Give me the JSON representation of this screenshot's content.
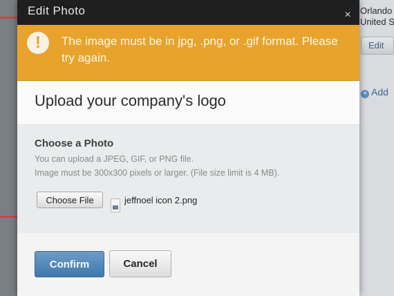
{
  "dialog": {
    "title": "Edit Photo",
    "close_label": "×",
    "alert": {
      "icon": "exclamation-icon",
      "icon_glyph": "!",
      "message": "The image must be in jpg, .png, or .gif format. Please try again."
    },
    "heading": "Upload your company's logo",
    "upload": {
      "title": "Choose a Photo",
      "help_line1": "You can upload a JPEG, GIF, or PNG file.",
      "help_line2": "Image must be 300x300 pixels or larger. (File size limit is 4 MB).",
      "choose_file_label": "Choose File",
      "file_name": "jeffnoel icon 2.png"
    },
    "buttons": {
      "confirm": "Confirm",
      "cancel": "Cancel"
    }
  },
  "background_page": {
    "city": "Orlando",
    "country": "United S",
    "edit_label": "Edit",
    "add_label": "Add"
  },
  "colors": {
    "alert": "#e7a32c",
    "header": "#1f1f1f",
    "confirm": "#4a7fb4"
  }
}
